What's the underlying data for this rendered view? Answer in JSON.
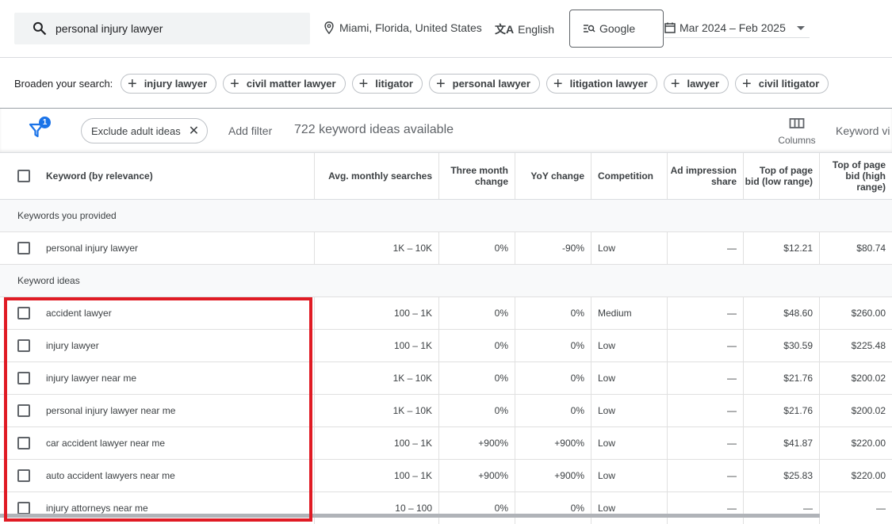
{
  "topbar": {
    "search_value": "personal injury lawyer",
    "location": "Miami, Florida, United States",
    "language": "English",
    "network": "Google",
    "date_range": "Mar 2024 – Feb 2025"
  },
  "broaden": {
    "label": "Broaden your search:",
    "chips": [
      "injury lawyer",
      "civil matter lawyer",
      "litigator",
      "personal lawyer",
      "litigation lawyer",
      "lawyer",
      "civil litigator"
    ]
  },
  "filterbar": {
    "filter_badge": "1",
    "exclude_chip": "Exclude adult ideas",
    "add_filter": "Add filter",
    "count_text": "722 keyword ideas available",
    "columns_label": "Columns",
    "keyword_view": "Keyword vi"
  },
  "table": {
    "headers": {
      "keyword": "Keyword (by relevance)",
      "avg": "Avg. monthly searches",
      "three_month": "Three month change",
      "yoy": "YoY change",
      "competition": "Competition",
      "ad_share": "Ad impression share",
      "bid_low": "Top of page bid (low range)",
      "bid_high": "Top of page bid (high range)"
    },
    "provided_group": "Keywords you provided",
    "provided_rows": [
      {
        "keyword": "personal injury lawyer",
        "avg": "1K – 10K",
        "three_month": "0%",
        "yoy": "-90%",
        "competition": "Low",
        "ad_share": "—",
        "bid_low": "$12.21",
        "bid_high": "$80.74"
      }
    ],
    "ideas_group": "Keyword ideas",
    "idea_rows": [
      {
        "keyword": "accident lawyer",
        "avg": "100 – 1K",
        "three_month": "0%",
        "yoy": "0%",
        "competition": "Medium",
        "ad_share": "—",
        "bid_low": "$48.60",
        "bid_high": "$260.00"
      },
      {
        "keyword": "injury lawyer",
        "avg": "100 – 1K",
        "three_month": "0%",
        "yoy": "0%",
        "competition": "Low",
        "ad_share": "—",
        "bid_low": "$30.59",
        "bid_high": "$225.48"
      },
      {
        "keyword": "injury lawyer near me",
        "avg": "1K – 10K",
        "three_month": "0%",
        "yoy": "0%",
        "competition": "Low",
        "ad_share": "—",
        "bid_low": "$21.76",
        "bid_high": "$200.02"
      },
      {
        "keyword": "personal injury lawyer near me",
        "avg": "1K – 10K",
        "three_month": "0%",
        "yoy": "0%",
        "competition": "Low",
        "ad_share": "—",
        "bid_low": "$21.76",
        "bid_high": "$200.02"
      },
      {
        "keyword": "car accident lawyer near me",
        "avg": "100 – 1K",
        "three_month": "+900%",
        "yoy": "+900%",
        "competition": "Low",
        "ad_share": "—",
        "bid_low": "$41.87",
        "bid_high": "$220.00"
      },
      {
        "keyword": "auto accident lawyers near me",
        "avg": "100 – 1K",
        "three_month": "+900%",
        "yoy": "+900%",
        "competition": "Low",
        "ad_share": "—",
        "bid_low": "$25.83",
        "bid_high": "$220.00"
      },
      {
        "keyword": "injury attorneys near me",
        "avg": "10 – 100",
        "three_month": "0%",
        "yoy": "0%",
        "competition": "Low",
        "ad_share": "—",
        "bid_low": "—",
        "bid_high": "—"
      }
    ]
  },
  "colors": {
    "highlight": "#e01b24",
    "accent": "#1a73e8"
  }
}
